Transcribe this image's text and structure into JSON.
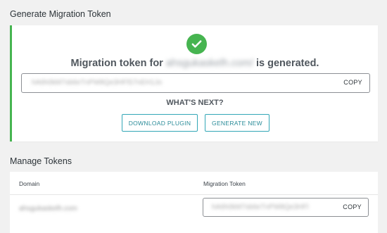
{
  "generate": {
    "section_title": "Generate Migration Token",
    "message_prefix": "Migration token for",
    "domain": "ahsgukaskelh.com/",
    "message_suffix": "is generated.",
    "token": "hA6h0kM7sb6eTnPW8Qe3HFlS7nEH1Jo",
    "copy_label": "COPY",
    "whats_next": "WHAT'S NEXT?",
    "download_label": "DOWNLOAD PLUGIN",
    "generate_new_label": "GENERATE NEW",
    "success_color": "#46b450",
    "accent_color": "#33a7b7",
    "icon": "checkmark-icon"
  },
  "manage": {
    "section_title": "Manage Tokens",
    "headers": {
      "domain": "Domain",
      "token": "Migration Token"
    },
    "rows": [
      {
        "domain": "ahsgukaskelh.com",
        "token": "hA6h0kM7sb6eTnPW8Qe3HFl",
        "copy_label": "COPY"
      }
    ]
  }
}
